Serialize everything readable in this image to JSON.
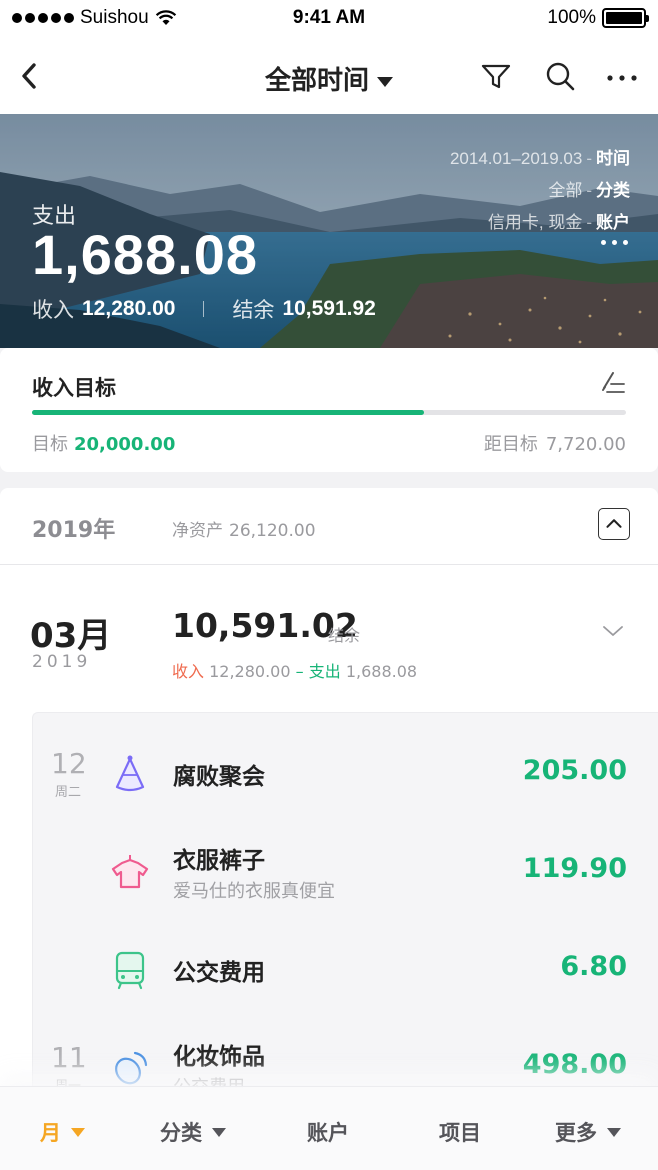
{
  "status_bar": {
    "carrier": "Suishou",
    "time": "9:41 AM",
    "battery": "100%"
  },
  "nav": {
    "title": "全部时间",
    "back_icon": "chevron-left-icon",
    "filter_icon": "filter-icon",
    "search_icon": "search-icon",
    "more_icon": "more-icon"
  },
  "hero": {
    "expense_label": "支出",
    "expense_amount": "1,688.08",
    "income_label": "收入",
    "income_amount": "12,280.00",
    "balance_label": "结余",
    "balance_amount": "10,591.92",
    "filters": [
      {
        "value": "2014.01–2019.03",
        "key": "时间"
      },
      {
        "value": "全部",
        "key": "分类"
      },
      {
        "value": "信用卡, 现金",
        "key": "账户"
      }
    ]
  },
  "goal": {
    "title": "收入目标",
    "target_label": "目标",
    "target_value": "20,000.00",
    "remain_label": "距目标",
    "remain_value": "7,720.00",
    "progress": 0.66,
    "accent": "#17b477"
  },
  "year": {
    "label": "2019年",
    "net_label": "净资产",
    "net_value": "26,120.00"
  },
  "month": {
    "label": "03月",
    "year": "2019",
    "balance": "10,591.02",
    "balance_label": "结余",
    "income_label": "收入",
    "income": "12,280.00",
    "dash": "–",
    "expense_label": "支出",
    "expense": "1,688.08"
  },
  "transactions": [
    {
      "day": "12",
      "weekday": "周二",
      "name": "腐败聚会",
      "note": "",
      "amount": "205.00",
      "icon": "party-hat-icon",
      "icon_color": "#7b6cf6"
    },
    {
      "day": "",
      "weekday": "",
      "name": "衣服裤子",
      "note": "爱马仕的衣服真便宜",
      "amount": "119.90",
      "icon": "clothes-icon",
      "icon_color": "#ef5b8f"
    },
    {
      "day": "",
      "weekday": "",
      "name": "公交费用",
      "note": "",
      "amount": "6.80",
      "icon": "bus-icon",
      "icon_color": "#3cc48a"
    },
    {
      "day": "11",
      "weekday": "周一",
      "name": "化妆饰品",
      "note": "公交费用",
      "amount": "498.00",
      "icon": "cosmetics-icon",
      "icon_color": "#4a90e2"
    }
  ],
  "tabs": [
    {
      "label": "月",
      "dropdown": true,
      "active": true
    },
    {
      "label": "分类",
      "dropdown": true,
      "active": false
    },
    {
      "label": "账户",
      "dropdown": false,
      "active": false
    },
    {
      "label": "项目",
      "dropdown": false,
      "active": false
    },
    {
      "label": "更多",
      "dropdown": true,
      "active": false
    }
  ],
  "colors": {
    "green": "#17b477",
    "orange": "#f5a623",
    "red": "#ef6b4f"
  }
}
